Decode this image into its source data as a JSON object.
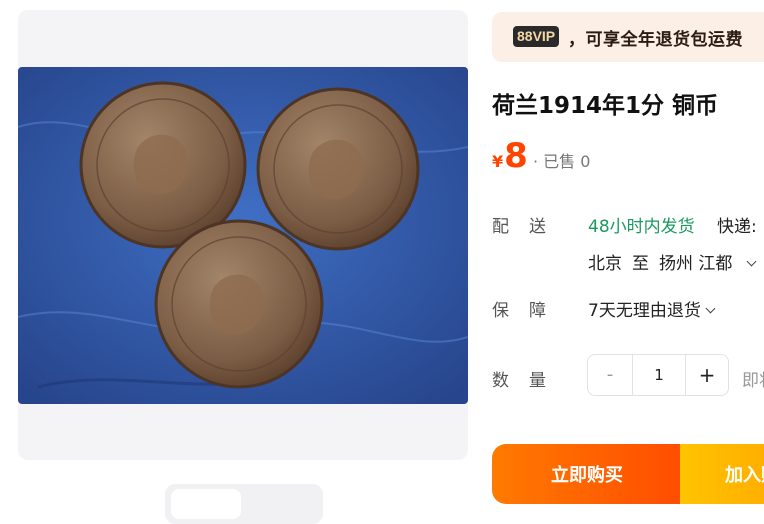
{
  "vip": {
    "badge": "88VIP",
    "text": "，可享全年退货包运费"
  },
  "product": {
    "title": "荷兰1914年1分 铜币",
    "currency": "¥",
    "price": "8",
    "sold": "· 已售 0"
  },
  "shipping": {
    "label": "配送",
    "time": "48小时内发货",
    "express": "快递: ",
    "from": "北京",
    "to_word": "至",
    "dest": "扬州 江都"
  },
  "guarantee": {
    "label": "保障",
    "text": "7天无理由退货"
  },
  "quantity": {
    "label": "数量",
    "minus": "-",
    "value": "1",
    "plus": "+",
    "available": "即将"
  },
  "actions": {
    "buy_now": "立即购买",
    "add_cart": "加入购物车"
  },
  "colors": {
    "accent": "#ff4400",
    "green": "#1a9a5e",
    "buy": "#ff5a00",
    "cart": "#ffb800"
  }
}
